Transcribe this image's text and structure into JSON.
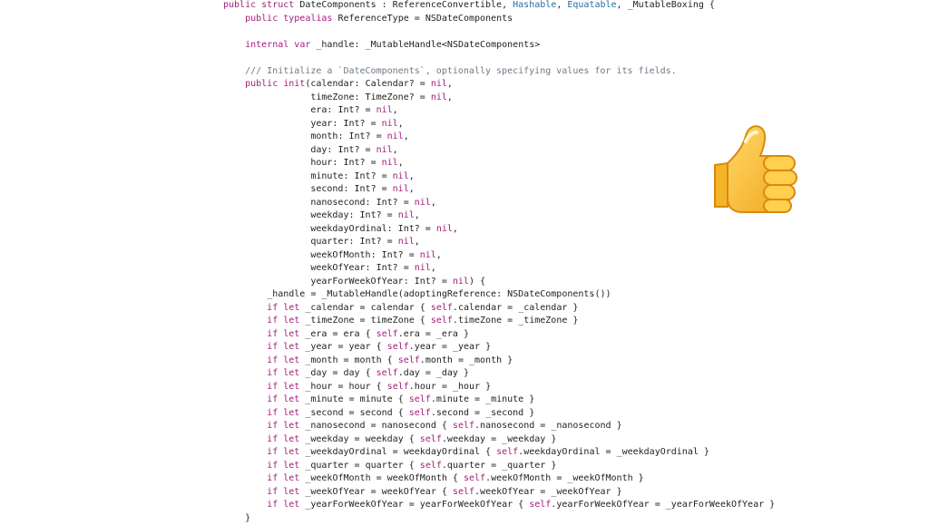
{
  "code_lines": [
    "public struct DateComponents : ReferenceConvertible, Hashable, Equatable, _MutableBoxing {",
    "    public typealias ReferenceType = NSDateComponents",
    "",
    "    internal var _handle: _MutableHandle<NSDateComponents>",
    "",
    "    /// Initialize a `DateComponents`, optionally specifying values for its fields.",
    "    public init(calendar: Calendar? = nil,",
    "                timeZone: TimeZone? = nil,",
    "                era: Int? = nil,",
    "                year: Int? = nil,",
    "                month: Int? = nil,",
    "                day: Int? = nil,",
    "                hour: Int? = nil,",
    "                minute: Int? = nil,",
    "                second: Int? = nil,",
    "                nanosecond: Int? = nil,",
    "                weekday: Int? = nil,",
    "                weekdayOrdinal: Int? = nil,",
    "                quarter: Int? = nil,",
    "                weekOfMonth: Int? = nil,",
    "                weekOfYear: Int? = nil,",
    "                yearForWeekOfYear: Int? = nil) {",
    "        _handle = _MutableHandle(adoptingReference: NSDateComponents())",
    "        if let _calendar = calendar { self.calendar = _calendar }",
    "        if let _timeZone = timeZone { self.timeZone = _timeZone }",
    "        if let _era = era { self.era = _era }",
    "        if let _year = year { self.year = _year }",
    "        if let _month = month { self.month = _month }",
    "        if let _day = day { self.day = _day }",
    "        if let _hour = hour { self.hour = _hour }",
    "        if let _minute = minute { self.minute = _minute }",
    "        if let _second = second { self.second = _second }",
    "        if let _nanosecond = nanosecond { self.nanosecond = _nanosecond }",
    "        if let _weekday = weekday { self.weekday = _weekday }",
    "        if let _weekdayOrdinal = weekdayOrdinal { self.weekdayOrdinal = _weekdayOrdinal }",
    "        if let _quarter = quarter { self.quarter = _quarter }",
    "        if let _weekOfMonth = weekOfMonth { self.weekOfMonth = _weekOfMonth }",
    "        if let _weekOfYear = weekOfYear { self.weekOfYear = _weekOfYear }",
    "        if let _yearForWeekOfYear = yearForWeekOfYear { self.yearForWeekOfYear = _yearForWeekOfYear }",
    "    }"
  ],
  "emoji": {
    "name": "thumbs-up-icon"
  },
  "colors": {
    "keyword": "#a31d7a",
    "type": "#1f6fa0",
    "comment": "#6f7a84",
    "text": "#1f1f1f",
    "background": "#ffffff"
  }
}
